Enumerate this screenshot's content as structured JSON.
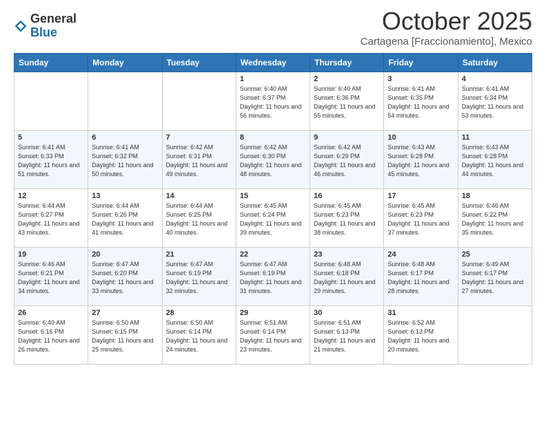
{
  "logo": {
    "general": "General",
    "blue": "Blue"
  },
  "header": {
    "month": "October 2025",
    "location": "Cartagena [Fraccionamiento], Mexico"
  },
  "weekdays": [
    "Sunday",
    "Monday",
    "Tuesday",
    "Wednesday",
    "Thursday",
    "Friday",
    "Saturday"
  ],
  "weeks": [
    [
      {
        "day": "",
        "info": ""
      },
      {
        "day": "",
        "info": ""
      },
      {
        "day": "",
        "info": ""
      },
      {
        "day": "1",
        "info": "Sunrise: 6:40 AM\nSunset: 6:37 PM\nDaylight: 11 hours and 56 minutes."
      },
      {
        "day": "2",
        "info": "Sunrise: 6:40 AM\nSunset: 6:36 PM\nDaylight: 11 hours and 55 minutes."
      },
      {
        "day": "3",
        "info": "Sunrise: 6:41 AM\nSunset: 6:35 PM\nDaylight: 11 hours and 54 minutes."
      },
      {
        "day": "4",
        "info": "Sunrise: 6:41 AM\nSunset: 6:34 PM\nDaylight: 11 hours and 53 minutes."
      }
    ],
    [
      {
        "day": "5",
        "info": "Sunrise: 6:41 AM\nSunset: 6:33 PM\nDaylight: 11 hours and 51 minutes."
      },
      {
        "day": "6",
        "info": "Sunrise: 6:41 AM\nSunset: 6:32 PM\nDaylight: 11 hours and 50 minutes."
      },
      {
        "day": "7",
        "info": "Sunrise: 6:42 AM\nSunset: 6:31 PM\nDaylight: 11 hours and 49 minutes."
      },
      {
        "day": "8",
        "info": "Sunrise: 6:42 AM\nSunset: 6:30 PM\nDaylight: 11 hours and 48 minutes."
      },
      {
        "day": "9",
        "info": "Sunrise: 6:42 AM\nSunset: 6:29 PM\nDaylight: 11 hours and 46 minutes."
      },
      {
        "day": "10",
        "info": "Sunrise: 6:43 AM\nSunset: 6:28 PM\nDaylight: 11 hours and 45 minutes."
      },
      {
        "day": "11",
        "info": "Sunrise: 6:43 AM\nSunset: 6:28 PM\nDaylight: 11 hours and 44 minutes."
      }
    ],
    [
      {
        "day": "12",
        "info": "Sunrise: 6:44 AM\nSunset: 6:27 PM\nDaylight: 11 hours and 43 minutes."
      },
      {
        "day": "13",
        "info": "Sunrise: 6:44 AM\nSunset: 6:26 PM\nDaylight: 11 hours and 41 minutes."
      },
      {
        "day": "14",
        "info": "Sunrise: 6:44 AM\nSunset: 6:25 PM\nDaylight: 11 hours and 40 minutes."
      },
      {
        "day": "15",
        "info": "Sunrise: 6:45 AM\nSunset: 6:24 PM\nDaylight: 11 hours and 39 minutes."
      },
      {
        "day": "16",
        "info": "Sunrise: 6:45 AM\nSunset: 6:23 PM\nDaylight: 11 hours and 38 minutes."
      },
      {
        "day": "17",
        "info": "Sunrise: 6:45 AM\nSunset: 6:23 PM\nDaylight: 11 hours and 37 minutes."
      },
      {
        "day": "18",
        "info": "Sunrise: 6:46 AM\nSunset: 6:22 PM\nDaylight: 11 hours and 35 minutes."
      }
    ],
    [
      {
        "day": "19",
        "info": "Sunrise: 6:46 AM\nSunset: 6:21 PM\nDaylight: 11 hours and 34 minutes."
      },
      {
        "day": "20",
        "info": "Sunrise: 6:47 AM\nSunset: 6:20 PM\nDaylight: 11 hours and 33 minutes."
      },
      {
        "day": "21",
        "info": "Sunrise: 6:47 AM\nSunset: 6:19 PM\nDaylight: 11 hours and 32 minutes."
      },
      {
        "day": "22",
        "info": "Sunrise: 6:47 AM\nSunset: 6:19 PM\nDaylight: 11 hours and 31 minutes."
      },
      {
        "day": "23",
        "info": "Sunrise: 6:48 AM\nSunset: 6:18 PM\nDaylight: 11 hours and 29 minutes."
      },
      {
        "day": "24",
        "info": "Sunrise: 6:48 AM\nSunset: 6:17 PM\nDaylight: 11 hours and 28 minutes."
      },
      {
        "day": "25",
        "info": "Sunrise: 6:49 AM\nSunset: 6:17 PM\nDaylight: 11 hours and 27 minutes."
      }
    ],
    [
      {
        "day": "26",
        "info": "Sunrise: 6:49 AM\nSunset: 6:16 PM\nDaylight: 11 hours and 26 minutes."
      },
      {
        "day": "27",
        "info": "Sunrise: 6:50 AM\nSunset: 6:15 PM\nDaylight: 11 hours and 25 minutes."
      },
      {
        "day": "28",
        "info": "Sunrise: 6:50 AM\nSunset: 6:14 PM\nDaylight: 11 hours and 24 minutes."
      },
      {
        "day": "29",
        "info": "Sunrise: 6:51 AM\nSunset: 6:14 PM\nDaylight: 11 hours and 23 minutes."
      },
      {
        "day": "30",
        "info": "Sunrise: 6:51 AM\nSunset: 6:13 PM\nDaylight: 11 hours and 21 minutes."
      },
      {
        "day": "31",
        "info": "Sunrise: 6:52 AM\nSunset: 6:13 PM\nDaylight: 11 hours and 20 minutes."
      },
      {
        "day": "",
        "info": ""
      }
    ]
  ]
}
